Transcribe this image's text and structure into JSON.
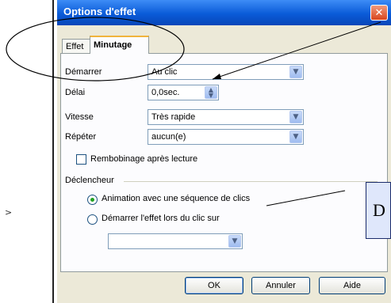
{
  "window": {
    "title": "Options d'effet",
    "close_icon": "close-icon"
  },
  "tabs": [
    {
      "label": "Effet",
      "active": false
    },
    {
      "label": "Minutage",
      "active": true
    }
  ],
  "form": {
    "demarrer": {
      "label": "Démarrer",
      "value": "Au clic"
    },
    "delai": {
      "label": "Délai",
      "value": "0,0sec."
    },
    "vitesse": {
      "label": "Vitesse",
      "value": "Très rapide"
    },
    "repeter": {
      "label": "Répéter",
      "value": "aucun(e)"
    },
    "rembobinage": {
      "label": "Rembobinage après lecture",
      "checked": false
    }
  },
  "trigger": {
    "group_label": "Déclencheur",
    "option1": {
      "label": "Animation avec une séquence de clics",
      "selected": true
    },
    "option2": {
      "label": "Démarrer l'effet lors du clic sur",
      "selected": false
    },
    "shape_select_value": ""
  },
  "buttons": {
    "ok": "OK",
    "cancel": "Annuler",
    "help": "Aide"
  },
  "callout": {
    "text": "D"
  },
  "colors": {
    "title_bar": "#0a5bd8",
    "dialog_bg": "#ece9d8",
    "close_button": "#d8461e",
    "active_tab_accent": "#f0b43c",
    "radio_selected": "#21a121",
    "callout_bg": "#dfe7fb"
  }
}
